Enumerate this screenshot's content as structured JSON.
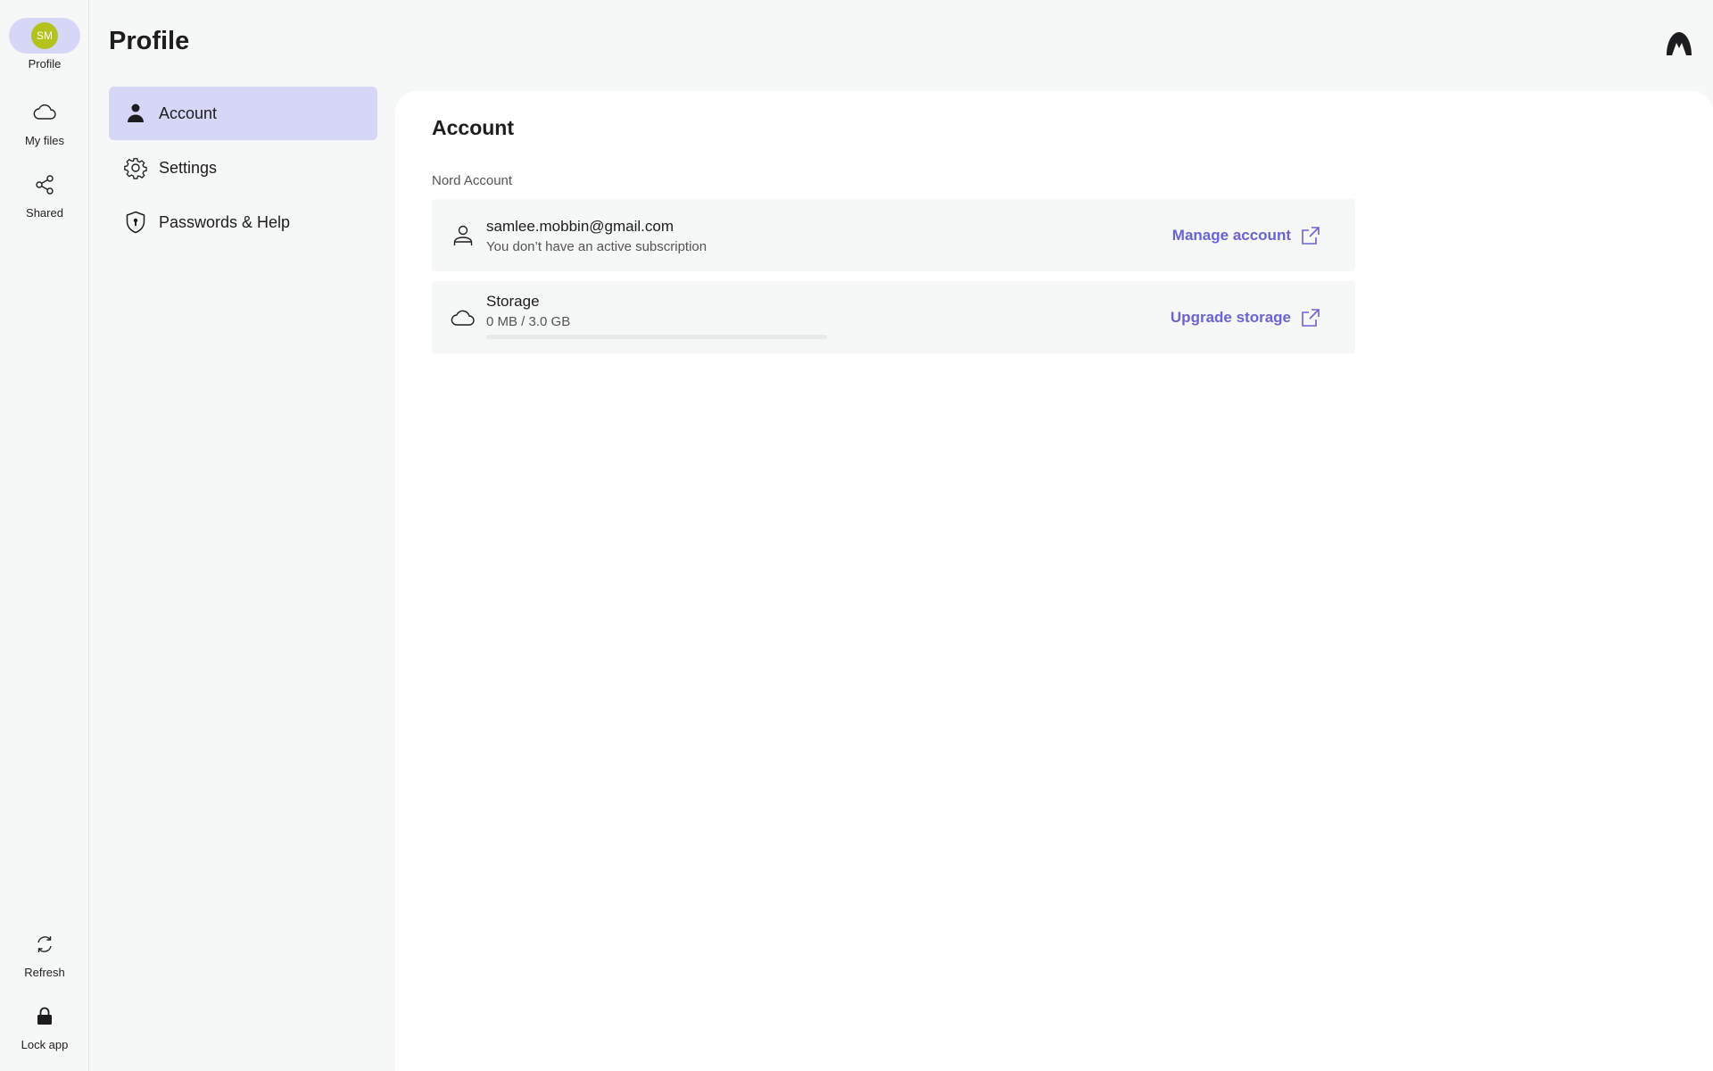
{
  "rail": {
    "profile": {
      "initials": "SM",
      "label": "Profile"
    },
    "my_files": {
      "label": "My files",
      "icon": "cloud-icon"
    },
    "shared": {
      "label": "Shared",
      "icon": "share-icon"
    },
    "refresh": {
      "label": "Refresh",
      "icon": "refresh-icon"
    },
    "lock": {
      "label": "Lock app",
      "icon": "lock-icon"
    }
  },
  "header": {
    "title": "Profile",
    "logo": "nordlocker-logo"
  },
  "menu": {
    "items": [
      {
        "label": "Account",
        "icon": "person-icon",
        "active": true
      },
      {
        "label": "Settings",
        "icon": "gear-icon",
        "active": false
      },
      {
        "label": "Passwords & Help",
        "icon": "shield-icon",
        "active": false
      }
    ]
  },
  "account": {
    "title": "Account",
    "group_label": "Nord Account",
    "user": {
      "email": "samlee.mobbin@gmail.com",
      "subscription": "You don’t have an active subscription",
      "action": "Manage account"
    },
    "storage": {
      "title": "Storage",
      "usage": "0 MB / 3.0 GB",
      "used_fraction": 0,
      "action": "Upgrade storage"
    }
  },
  "colors": {
    "accent": "#6b63d6",
    "active_bg": "#d6d6f6",
    "avatar": "#b3c21d"
  }
}
